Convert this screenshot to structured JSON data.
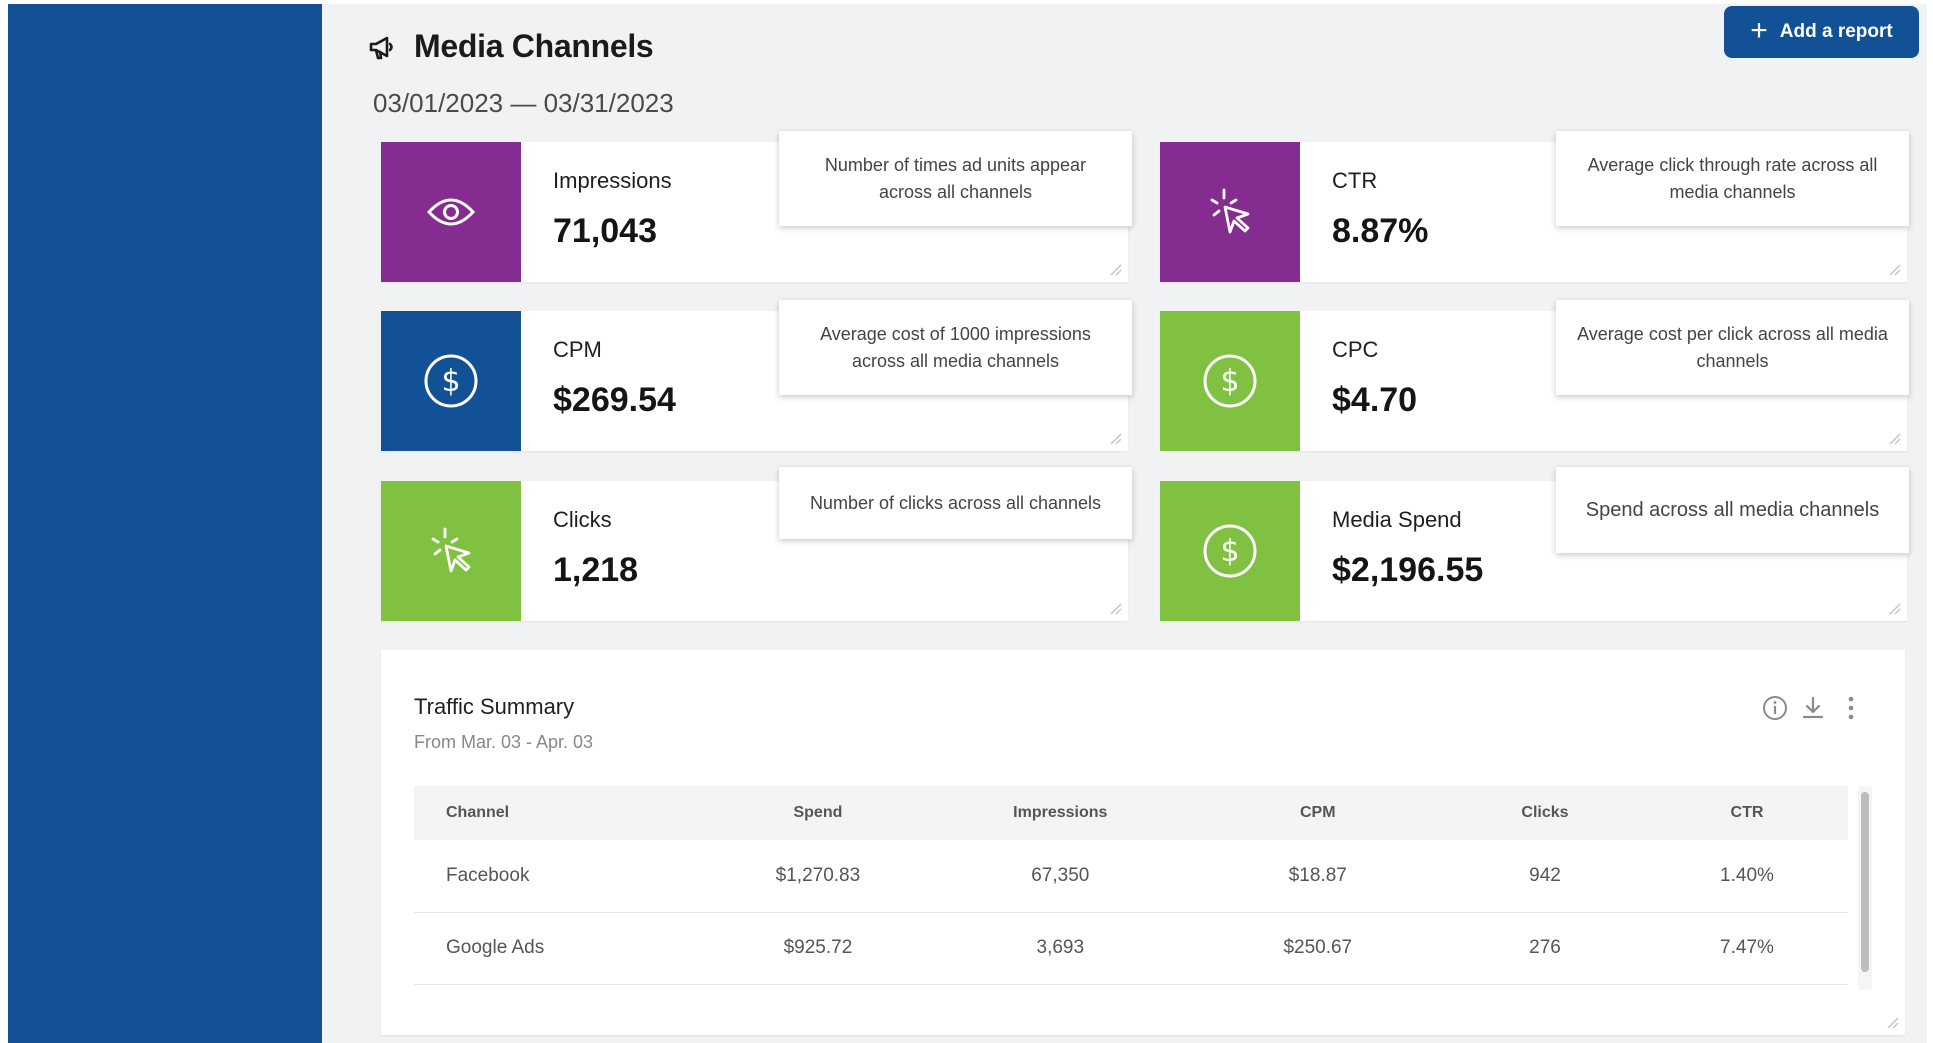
{
  "header": {
    "title": "Media Channels",
    "date_range": "03/01/2023 — 03/31/2023",
    "add_report_label": "Add a report"
  },
  "colors": {
    "sidebar": "#135197",
    "purple": "#852c91",
    "blue": "#135197",
    "green": "#80c142"
  },
  "cards": [
    {
      "label": "Impressions",
      "value": "71,043",
      "icon": "eye-icon",
      "color": "#852c91",
      "tooltip": "Number of times ad units appear across all channels"
    },
    {
      "label": "CTR",
      "value": "8.87%",
      "icon": "cursor-click-icon",
      "color": "#852c91",
      "tooltip": "Average click through rate across all media channels"
    },
    {
      "label": "CPM",
      "value": "$269.54",
      "icon": "dollar-icon",
      "color": "#135197",
      "tooltip": "Average cost of 1000 impressions across all media channels"
    },
    {
      "label": "CPC",
      "value": "$4.70",
      "icon": "dollar-icon",
      "color": "#80c142",
      "tooltip": "Average cost per click across all media channels"
    },
    {
      "label": "Clicks",
      "value": "1,218",
      "icon": "cursor-click-icon",
      "color": "#80c142",
      "tooltip": "Number of clicks across all channels"
    },
    {
      "label": "Media Spend",
      "value": "$2,196.55",
      "icon": "dollar-icon",
      "color": "#80c142",
      "tooltip": "Spend across all media channels"
    }
  ],
  "traffic": {
    "title": "Traffic Summary",
    "subtitle": "From Mar. 03 - Apr. 03",
    "columns": [
      "Channel",
      "Spend",
      "Impressions",
      "CPM",
      "Clicks",
      "CTR"
    ],
    "rows": [
      [
        "Facebook",
        "$1,270.83",
        "67,350",
        "$18.87",
        "942",
        "1.40%"
      ],
      [
        "Google Ads",
        "$925.72",
        "3,693",
        "$250.67",
        "276",
        "7.47%"
      ]
    ]
  }
}
